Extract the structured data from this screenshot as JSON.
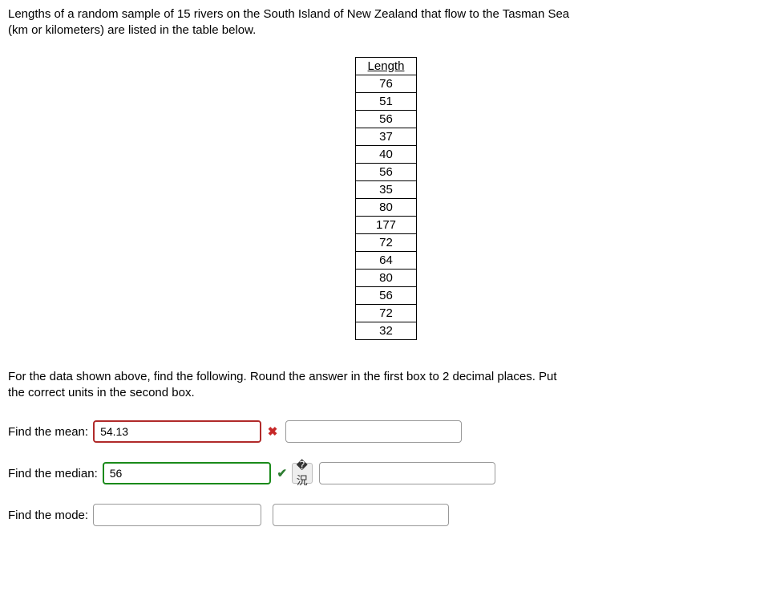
{
  "problem": {
    "intro_line1": "Lengths of a random sample of 15 rivers on the South Island of New Zealand that flow to the Tasman Sea",
    "intro_line2": "(km or kilometers) are listed in the table below."
  },
  "table": {
    "header": "Length",
    "values": [
      "76",
      "51",
      "56",
      "37",
      "40",
      "56",
      "35",
      "80",
      "177",
      "72",
      "64",
      "80",
      "56",
      "72",
      "32"
    ]
  },
  "instructions": {
    "line1": "For the data shown above, find the following. Round the answer in the first box to 2 decimal places. Put",
    "line2": "the correct units in the second box."
  },
  "answers": {
    "mean": {
      "label": "Find the mean:",
      "value": "54.13",
      "status": "incorrect",
      "units": ""
    },
    "median": {
      "label": "Find the median:",
      "value": "56",
      "status": "correct",
      "units": ""
    },
    "mode": {
      "label": "Find the mode:",
      "value": "",
      "units": ""
    }
  },
  "icons": {
    "incorrect": "✖",
    "correct": "✔",
    "retry": "�況"
  }
}
